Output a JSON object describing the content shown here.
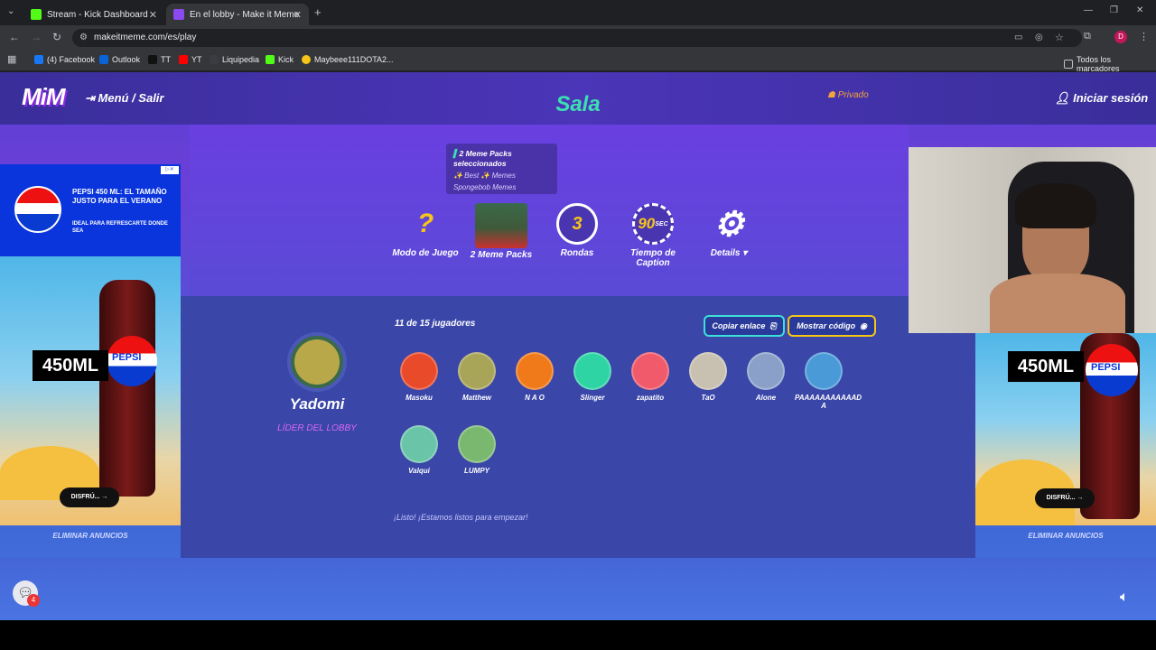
{
  "browser": {
    "tabs": [
      {
        "title": "Stream - Kick Dashboard"
      },
      {
        "title": "En el lobby - Make it Meme"
      }
    ],
    "url": "makeitmeme.com/es/play",
    "bookmarks": [
      "(4) Facebook",
      "Outlook",
      "TT",
      "YT",
      "Liquipedia",
      "Kick",
      "Maybeee111DOTA2..."
    ],
    "all_bookmarks": "Todos los marcadores",
    "profile_initial": "D"
  },
  "nav": {
    "logo": "MiM",
    "menu_label": "Menú / Salir",
    "room_title": "Sala",
    "privacy": "Privado",
    "login": "Iniciar sesión"
  },
  "packs_box": {
    "title": "2 Meme Packs seleccionados",
    "items": [
      "✨ Best ✨ Memes",
      "Spongebob Memes"
    ]
  },
  "settings": {
    "mode": {
      "icon": "?",
      "label": "Modo de Juego"
    },
    "packs": {
      "label": "2 Meme Packs"
    },
    "rounds": {
      "value": "3",
      "label": "Rondas"
    },
    "time": {
      "value": "90",
      "unit": "SEC",
      "label_line1": "Tiempo de",
      "label_line2": "Caption"
    },
    "details": {
      "label": "Details"
    }
  },
  "leader": {
    "name": "Yadomi",
    "role": "LÍDER DEL LOBBY"
  },
  "lobby": {
    "count_current": "11",
    "count_sep": "de",
    "count_max": "15 jugadores",
    "copy_link": "Copiar enlace",
    "show_code": "Mostrar código",
    "ready_text": "¡Listo! ¡Estamos listos para empezar!",
    "players": [
      {
        "name": "Masoku",
        "color": "#e84a2a"
      },
      {
        "name": "Matthew",
        "color": "#a8a458"
      },
      {
        "name": "N A O",
        "color": "#f07a1a"
      },
      {
        "name": "Slinger",
        "color": "#2ed4a4"
      },
      {
        "name": "zapatito",
        "color": "#f05a6a"
      },
      {
        "name": "TaO",
        "color": "#c8c0b0"
      },
      {
        "name": "Alone",
        "color": "#8aa0c8"
      },
      {
        "name": "PAAAAAAAAAAAD A",
        "color": "#4a9ad8"
      },
      {
        "name": "Valqui",
        "color": "#6ac4a8"
      },
      {
        "name": "LUMPY",
        "color": "#7ab870"
      }
    ]
  },
  "ads": {
    "left_headline": "PEPSI 450 ML: EL TAMAÑO JUSTO PARA EL VERANO",
    "left_sub": "IDEAL PARA REFRESCARTE DONDE SEA",
    "brand": "PEPSI",
    "size": "450ML",
    "cta": "DISFRÚ...",
    "remove": "ELIMINAR ANUNCIOS"
  },
  "chat_badge": "4",
  "colors": {
    "accent": "#3ce0b0",
    "privado": "#f2a33a",
    "leader": "#d86af0"
  }
}
